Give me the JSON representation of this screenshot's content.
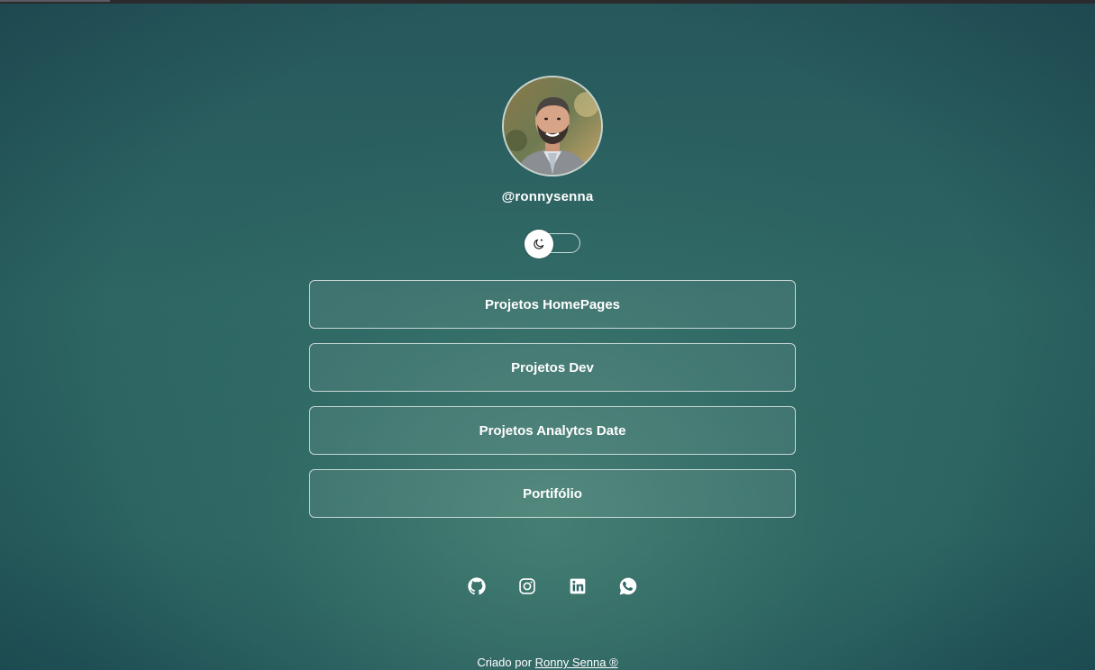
{
  "profile": {
    "username": "@ronnysenna"
  },
  "theme_toggle": {
    "icon": "moon-icon"
  },
  "links": [
    {
      "label": "Projetos HomePages"
    },
    {
      "label": "Projetos Dev"
    },
    {
      "label": "Projetos Analytcs Date"
    },
    {
      "label": "Portifólio"
    }
  ],
  "socials": [
    {
      "icon": "github-icon"
    },
    {
      "icon": "instagram-icon"
    },
    {
      "icon": "linkedin-icon"
    },
    {
      "icon": "whatsapp-icon"
    }
  ],
  "footer": {
    "prefix": "Criado por",
    "author": "Ronny Senna",
    "mark": "®"
  },
  "colors": {
    "background": "#2d6663",
    "text": "#ffffff",
    "button_border": "#ffffff"
  }
}
